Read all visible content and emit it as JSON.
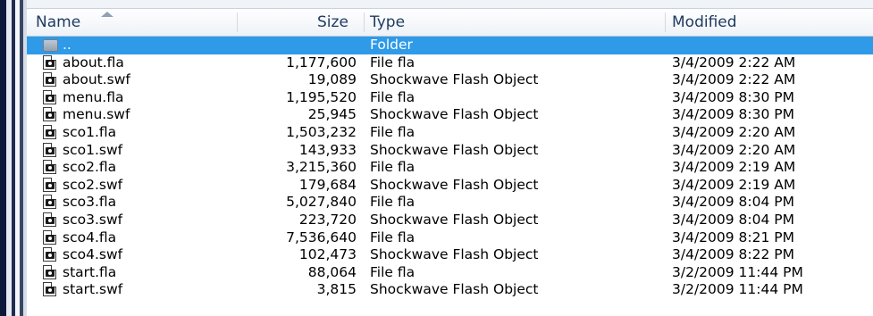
{
  "columns": {
    "name": "Name",
    "size": "Size",
    "type": "Type",
    "modified": "Modified"
  },
  "parent_row": {
    "name": "..",
    "size": "",
    "type": "Folder",
    "modified": "",
    "icon": "folder-up-icon"
  },
  "files": [
    {
      "name": "about.fla",
      "size": "1,177,600",
      "type": "File fla",
      "modified": "3/4/2009 2:22 AM",
      "icon": "flash-file-icon"
    },
    {
      "name": "about.swf",
      "size": "19,089",
      "type": "Shockwave Flash Object",
      "modified": "3/4/2009 2:22 AM",
      "icon": "flash-file-icon"
    },
    {
      "name": "menu.fla",
      "size": "1,195,520",
      "type": "File fla",
      "modified": "3/4/2009 8:30 PM",
      "icon": "flash-file-icon"
    },
    {
      "name": "menu.swf",
      "size": "25,945",
      "type": "Shockwave Flash Object",
      "modified": "3/4/2009 8:30 PM",
      "icon": "flash-file-icon"
    },
    {
      "name": "sco1.fla",
      "size": "1,503,232",
      "type": "File fla",
      "modified": "3/4/2009 2:20 AM",
      "icon": "flash-file-icon"
    },
    {
      "name": "sco1.swf",
      "size": "143,933",
      "type": "Shockwave Flash Object",
      "modified": "3/4/2009 2:20 AM",
      "icon": "flash-file-icon"
    },
    {
      "name": "sco2.fla",
      "size": "3,215,360",
      "type": "File fla",
      "modified": "3/4/2009 2:19 AM",
      "icon": "flash-file-icon"
    },
    {
      "name": "sco2.swf",
      "size": "179,684",
      "type": "Shockwave Flash Object",
      "modified": "3/4/2009 2:19 AM",
      "icon": "flash-file-icon"
    },
    {
      "name": "sco3.fla",
      "size": "5,027,840",
      "type": "File fla",
      "modified": "3/4/2009 8:04 PM",
      "icon": "flash-file-icon"
    },
    {
      "name": "sco3.swf",
      "size": "223,720",
      "type": "Shockwave Flash Object",
      "modified": "3/4/2009 8:04 PM",
      "icon": "flash-file-icon"
    },
    {
      "name": "sco4.fla",
      "size": "7,536,640",
      "type": "File fla",
      "modified": "3/4/2009 8:21 PM",
      "icon": "flash-file-icon"
    },
    {
      "name": "sco4.swf",
      "size": "102,473",
      "type": "Shockwave Flash Object",
      "modified": "3/4/2009 8:22 PM",
      "icon": "flash-file-icon"
    },
    {
      "name": "start.fla",
      "size": "88,064",
      "type": "File fla",
      "modified": "3/2/2009 11:44 PM",
      "icon": "flash-file-icon"
    },
    {
      "name": "start.swf",
      "size": "3,815",
      "type": "Shockwave Flash Object",
      "modified": "3/2/2009 11:44 PM",
      "icon": "flash-file-icon"
    }
  ],
  "colors": {
    "selection": "#2f9ae8",
    "header_text": "#1e3a5f",
    "frame_dark": "#0e1a3a"
  },
  "sort": {
    "column": "Name",
    "direction": "ascending"
  }
}
